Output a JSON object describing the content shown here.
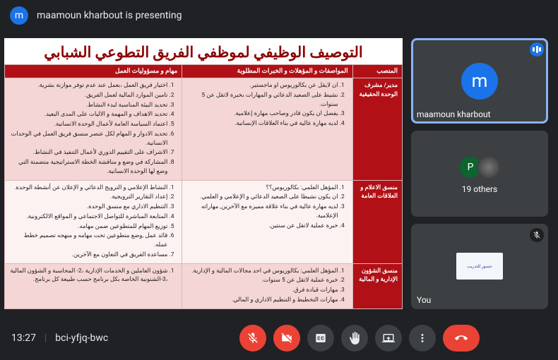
{
  "header": {
    "avatar_initial": "m",
    "presenting_text": "maamoun kharbout is presenting"
  },
  "presentation": {
    "title": "التوصيف الوظيفي لموظفي الفريق التطوعي الشبابي",
    "headers": {
      "col1": "المنصب",
      "col2": "المواصفات و المؤهلات و الخبرات المطلوبة",
      "col3": "مهام و مسؤوليات العمل"
    },
    "rows": [
      {
        "label": "مدير/ مشرف الوحدة\nالحقيقية",
        "mid": [
          "ان لايقل عن بكالوريوس او ماجستير.",
          "نشيط على الصعيد الدعائي و المهارات بخبرة لاتقل عن 5 سنوات.",
          "يفضل ان يكون قادر وصاحب مهارة إعلامية.",
          "لديه مهارة عالية في بناء العلاقات الإنسانية."
        ],
        "left": [
          "اختيار فريق العمل ،بعمل عند عدم توفر موازنة بشرية.",
          "تامين الموارد المالية لعمل الفريق.",
          "تحديد البيئة المناسبة لبدء النشاط.",
          "تحديد الاهداف و المهمة و الاليات على المدى البعيد.",
          "اعتماد السياسة العامة لأعمال الوحدة الانسانية.",
          "تحديد الادوار و المهام لكل عنصر منسق فريق العمل في الوحدات الانسانية.",
          "الاشراف على التقييم الدوري لأعمال التنفيذ في النشاط.",
          "المشاركة في وضع و مناقشة الخطة الاستراتيجية متضمنة التي وضع لها الوحدة الانسانية."
        ]
      },
      {
        "label": "منسق الاعلام و العلاقات\nالعامة",
        "mid": [
          "المؤهل العلمي: بكالوريوس؟؟",
          "ان يكون نشيطا على الصعيد الدعائي و الإعلامي و العلمي.",
          "لديه مهارة عالية في بناء علاقة مميزة مع الآخرين, مهاراته الإعلامية.",
          "خبرة عملية لاتقل عن سنتين."
        ],
        "left": [
          "النشاط الإعلامي و الترويج الدعائي و الإعلان عن أنشطة الوحدة.",
          "إعداد التقارير الترويجية.",
          "التنظيم الاداري مع منسق الوحدة.",
          "المتابعة المباشرة للتواصل الاجتماعي و المواقع الالكترونية.",
          "توزيع المهام للمتطوعين ضمن مهامه.",
          "قائد عمل ,وضع متطوعين تحت مهامه و منهجه تصميم خطط عمله.",
          "مساعدة الفريق في التعاون مع الآخرين."
        ]
      },
      {
        "label": "منسق الشؤون الإدارية و\nالمالية",
        "mid": [
          "المؤهل العلمي: بكالوريوس في احد مجالات المالية و الإدارية.",
          "خبرة عملية لاتقل عن 5 سنوات.",
          "مهارات قيادة فرق.",
          "مهارات التخطيط و التنظيم الاداري و المالي."
        ],
        "left": [
          "شؤون العاملين و الخدمات الإدارية ،2- المحاسبة و الشؤون المالية ،3-الشنونية الخاصة بكل برنامج حسب طبيعة كل برنامج."
        ]
      }
    ]
  },
  "participants": {
    "p1": {
      "initial": "m",
      "name": "maamoun kharbout"
    },
    "p2": {
      "initial": "P",
      "count_label": "19 others"
    },
    "p3": {
      "you_label": "You",
      "logo_text": "جسور للتدريب"
    }
  },
  "footer": {
    "time": "13:27",
    "code": "bci-yfjq-bwc"
  }
}
